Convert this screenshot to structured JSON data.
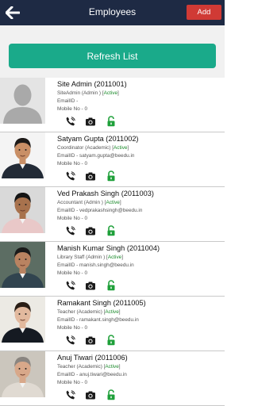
{
  "header": {
    "title": "Employees",
    "add_label": "Add"
  },
  "refresh_label": "Refresh List",
  "employees": [
    {
      "name": "Site Admin (2011001)",
      "role_prefix": "SiteAdmin (Admin ) [",
      "status": "Active",
      "role_suffix": "]",
      "email": "EmailID -",
      "mobile": "Mobile No - 0",
      "avatar": "placeholder"
    },
    {
      "name": "Satyam Gupta (2011002)",
      "role_prefix": "Coordinator (Academic) [",
      "status": "Active",
      "role_suffix": "]",
      "email": "EmailID - satyam.gupta@beedu.in",
      "mobile": "Mobile No - 0",
      "avatar": "photo"
    },
    {
      "name": "Ved Prakash Singh (2011003)",
      "role_prefix": "Accountant (Admin ) [",
      "status": "Active",
      "role_suffix": "]",
      "email": "EmailID - vedprakashsingh@beedu.in",
      "mobile": "Mobile No - 0",
      "avatar": "photo"
    },
    {
      "name": "Manish Kumar Singh (2011004)",
      "role_prefix": "Library Staff (Admin ) [",
      "status": "Active",
      "role_suffix": "]",
      "email": "EmailID - manish.singh@beedu.in",
      "mobile": "Mobile No - 0",
      "avatar": "photo"
    },
    {
      "name": "Ramakant Singh (2011005)",
      "role_prefix": "Teacher (Academic) [",
      "status": "Active",
      "role_suffix": "]",
      "email": "EmailID - ramakant.singh@beedu.in",
      "mobile": "Mobile No - 0",
      "avatar": "photo"
    },
    {
      "name": "Anuj Tiwari (2011006)",
      "role_prefix": "Teacher (Academic) [",
      "status": "Active",
      "role_suffix": "]",
      "email": "EmailID - anuj.tiwari@beedu.in",
      "mobile": "Mobile No - 0",
      "avatar": "photo"
    }
  ],
  "icons": {
    "back": "back-arrow-icon",
    "call": "phone-icon",
    "camera": "camera-icon",
    "lock": "unlock-icon",
    "avatar": "person-silhouette-icon"
  },
  "colors": {
    "header": "#1e2a44",
    "add": "#d03a35",
    "refresh": "#1aaa8a",
    "active": "#1a8a2a",
    "lock": "#1fa03a"
  }
}
